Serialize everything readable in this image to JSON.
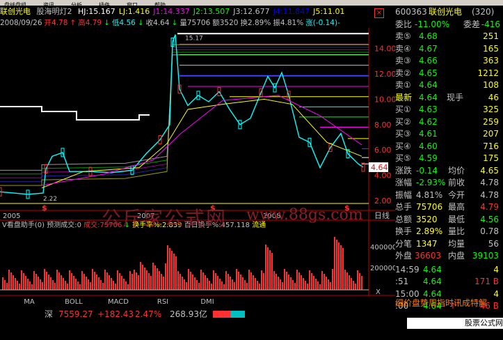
{
  "menu": [
    "盘线盘组",
    "资讯",
    "分析",
    "插件",
    "窗口",
    "帮助"
  ],
  "header": {
    "stock_name": "联创光电",
    "indicator_name": "股海明灯2",
    "params": [
      {
        "text": "HJ:15.167",
        "color": "#ffffff"
      },
      {
        "text": "LJ:1.416",
        "color": "#ffff00"
      },
      {
        "text": "J1:14.337",
        "color": "#ff00ff"
      },
      {
        "text": "J2:13.507",
        "color": "#00ff00"
      },
      {
        "text": "J3:12.677",
        "color": "#c0c0c0"
      },
      {
        "text": "J4:11.847",
        "color": "#0000ff"
      },
      {
        "text": "J5:11.01",
        "color": "#ffff00"
      }
    ],
    "close_icon": "×"
  },
  "quote_line": [
    {
      "text": "2008/09/26",
      "color": "#c0c0c0"
    },
    {
      "text": "开4.78",
      "color": "#ff3030"
    },
    {
      "text": "↑",
      "color": "#ff3030"
    },
    {
      "text": "高4.79",
      "color": "#ff3030"
    },
    {
      "text": "↓",
      "color": "#00ff00"
    },
    {
      "text": "低4.56",
      "color": "#00ffff"
    },
    {
      "text": "↓",
      "color": "#00ff00"
    },
    {
      "text": "收4.64",
      "color": "#c0c0c0"
    },
    {
      "text": "↓",
      "color": "#00ff00"
    },
    {
      "text": "量75706",
      "color": "#c0c0c0"
    },
    {
      "text": "额3520",
      "color": "#c0c0c0"
    },
    {
      "text": "换2.89%",
      "color": "#c0c0c0"
    },
    {
      "text": "振4.81%",
      "color": "#c0c0c0"
    },
    {
      "text": "涨(-0.14)-",
      "color": "#00ffff"
    }
  ],
  "price_axis": [
    "14.00",
    "12.00",
    "10.00",
    "8.00",
    "6.00",
    "4.00",
    "2.00"
  ],
  "current_price_tag": "4.64",
  "high_label": "15.17",
  "low_label": "2.22",
  "years": [
    "2005",
    "2007",
    "2008"
  ],
  "period_label": "日线",
  "volume_header": {
    "title": "V看盘助手(0)",
    "predicted": "预测成交:0",
    "volume": "成交:75706",
    "arrow": "↓",
    "turnover": "换手率%:2.839",
    "hundred_day": "百日换手%:457.118",
    "inflow": "流通"
  },
  "volume_axis": [
    "400000",
    "200000"
  ],
  "volume_bottom_label": "X",
  "watermark": "公斤家公式网",
  "watermark2": "www.88gs.com",
  "tabs": [
    "MA",
    "BOLL",
    "MACD",
    "RSI",
    "DMI"
  ],
  "index_status": {
    "name": "深",
    "value": "7559.27",
    "change": "+182.43",
    "pct": "2.47%",
    "amount": "268.93亿"
  },
  "footer_right": "股票公式网 www.88gs.com",
  "right": {
    "code": "600363",
    "name": "联创光电",
    "count": "(320)",
    "weibi_label": "委比",
    "weibi_value": "-11.00%",
    "weicha_label": "委差",
    "weicha_value": "-416",
    "sells": [
      {
        "label": "卖⑤",
        "price": "4.68",
        "vol": "251"
      },
      {
        "label": "卖④",
        "price": "4.67",
        "vol": "165"
      },
      {
        "label": "卖③",
        "price": "4.66",
        "vol": "363"
      },
      {
        "label": "卖②",
        "price": "4.65",
        "vol": "1212"
      },
      {
        "label": "卖①",
        "price": "4.64",
        "vol": "108"
      }
    ],
    "latest_label": "最新",
    "latest_price": "4.64",
    "hand_label": "现手",
    "hand_value": "46",
    "buys": [
      {
        "label": "买①",
        "price": "4.63",
        "vol": "325"
      },
      {
        "label": "买②",
        "price": "4.62",
        "vol": "259"
      },
      {
        "label": "买③",
        "price": "4.61",
        "vol": "207"
      },
      {
        "label": "买④",
        "price": "4.60",
        "vol": "716"
      },
      {
        "label": "买⑤",
        "price": "4.59",
        "vol": "175"
      }
    ],
    "stats": [
      {
        "l1": "涨跌",
        "v1": "-0.14",
        "c1": "#00ff00",
        "l2": "均价",
        "v2": "4.65",
        "c2": "#ffff00"
      },
      {
        "l1": "涨幅",
        "v1": "-2.93%",
        "c1": "#00ff00",
        "l2": "前收",
        "v2": "4.78",
        "c2": "#c0c0c0"
      },
      {
        "l1": "振幅",
        "v1": "4.81%",
        "c1": "#c0c0c0",
        "l2": "今开",
        "v2": "4.78",
        "c2": "#c0c0c0"
      },
      {
        "l1": "总手",
        "v1": "75706",
        "c1": "#ffff00",
        "l2": "最高",
        "v2": "4.79",
        "c2": "#ff3030"
      },
      {
        "l1": "总额",
        "v1": "3520",
        "c1": "#ffff00",
        "l2": "最低",
        "v2": "4.56",
        "c2": "#00ff00"
      },
      {
        "l1": "换手",
        "v1": "2.89%",
        "c1": "#ffff00",
        "l2": "量比",
        "v2": "0.78",
        "c2": "#c0c0c0"
      },
      {
        "l1": "分笔",
        "v1": "1347",
        "c1": "#ffff00",
        "l2": "均量",
        "v2": "56",
        "c2": "#c0c0c0"
      }
    ],
    "outer_label": "外盘",
    "outer_value": "36603",
    "inner_label": "内盘",
    "inner_value": "39103",
    "ticks": [
      {
        "time": "14:59",
        "price": "4.64",
        "arrow": "",
        "vol": "4",
        "vcolor": "#ffff00"
      },
      {
        "time": ":51",
        "price": "4.64",
        "arrow": "",
        "vol": "171 B",
        "vcolor": "#ff3030"
      },
      {
        "time": "15:00",
        "price": "4.64",
        "arrow": "",
        "vol": "4",
        "vcolor": "#ffff00"
      },
      {
        "time": ":00",
        "price": "4.64",
        "arrow": "↑",
        "vol": "46 B",
        "vcolor": "#ff3030"
      }
    ],
    "bottom_tabs": "细价盘势周指时讯成特解"
  }
}
